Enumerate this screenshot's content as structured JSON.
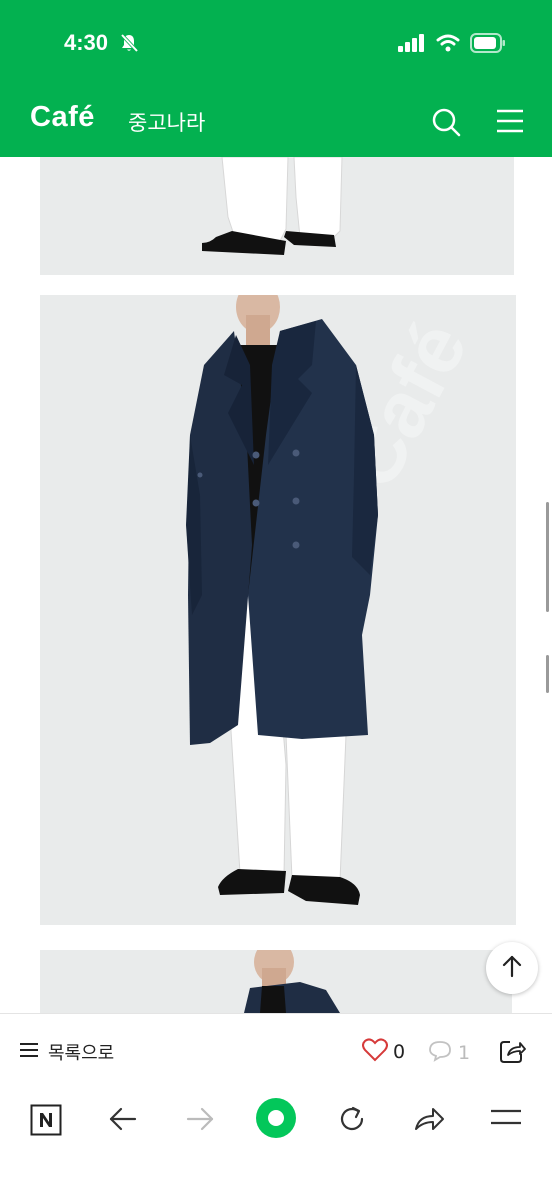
{
  "status_bar": {
    "time": "4:30"
  },
  "header": {
    "brand": "Café",
    "cafe_name": "중고나라",
    "icons": [
      "search-icon",
      "menu-icon"
    ],
    "background_color": "#03b150"
  },
  "content": {
    "images": [
      "coat-photo-bottom-crop",
      "coat-photo-full",
      "coat-photo-top-crop"
    ],
    "coat_color": "#1f2d44",
    "image_background": "#e9ebeb"
  },
  "action_bar": {
    "list_label": "목록으로",
    "like_count": "0",
    "comment_count": "1"
  },
  "browser_toolbar": {
    "icons": [
      "naver-n-icon",
      "back-arrow-icon",
      "forward-arrow-icon",
      "home-green-circle-icon",
      "reload-icon",
      "share-arrow-icon",
      "menu-lines-icon"
    ],
    "accent": "#03c75a"
  }
}
